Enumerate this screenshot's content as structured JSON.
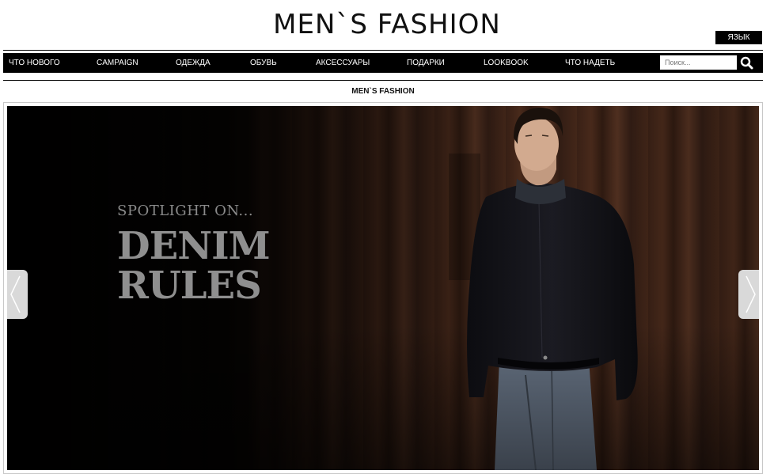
{
  "brand": {
    "logo_text": "MEN`S FASHION"
  },
  "header": {
    "language_button": "ЯЗЫК"
  },
  "nav": {
    "items": [
      {
        "label": "ЧТО НОВОГО"
      },
      {
        "label": "CAMPAIGN"
      },
      {
        "label": "ОДЕЖДА"
      },
      {
        "label": "ОБУВЬ"
      },
      {
        "label": "АКСЕССУАРЫ"
      },
      {
        "label": "ПОДАРКИ"
      },
      {
        "label": "LOOKBOOK"
      },
      {
        "label": "ЧТО НАДЕТЬ"
      }
    ],
    "search": {
      "placeholder": "Поиск...",
      "icon": "search-icon"
    }
  },
  "breadcrumb": {
    "label": "MEN`S FASHION"
  },
  "hero": {
    "kicker": "SPOTLIGHT ON...",
    "title_line1": "DENIM",
    "title_line2": "RULES",
    "prev_icon": "chevron-left-icon",
    "next_icon": "chevron-right-icon"
  },
  "colors": {
    "bar": "#000000",
    "text": "#111111",
    "hero_text": "#8f8f8f",
    "arrow_bg": "#d9d9d9"
  }
}
